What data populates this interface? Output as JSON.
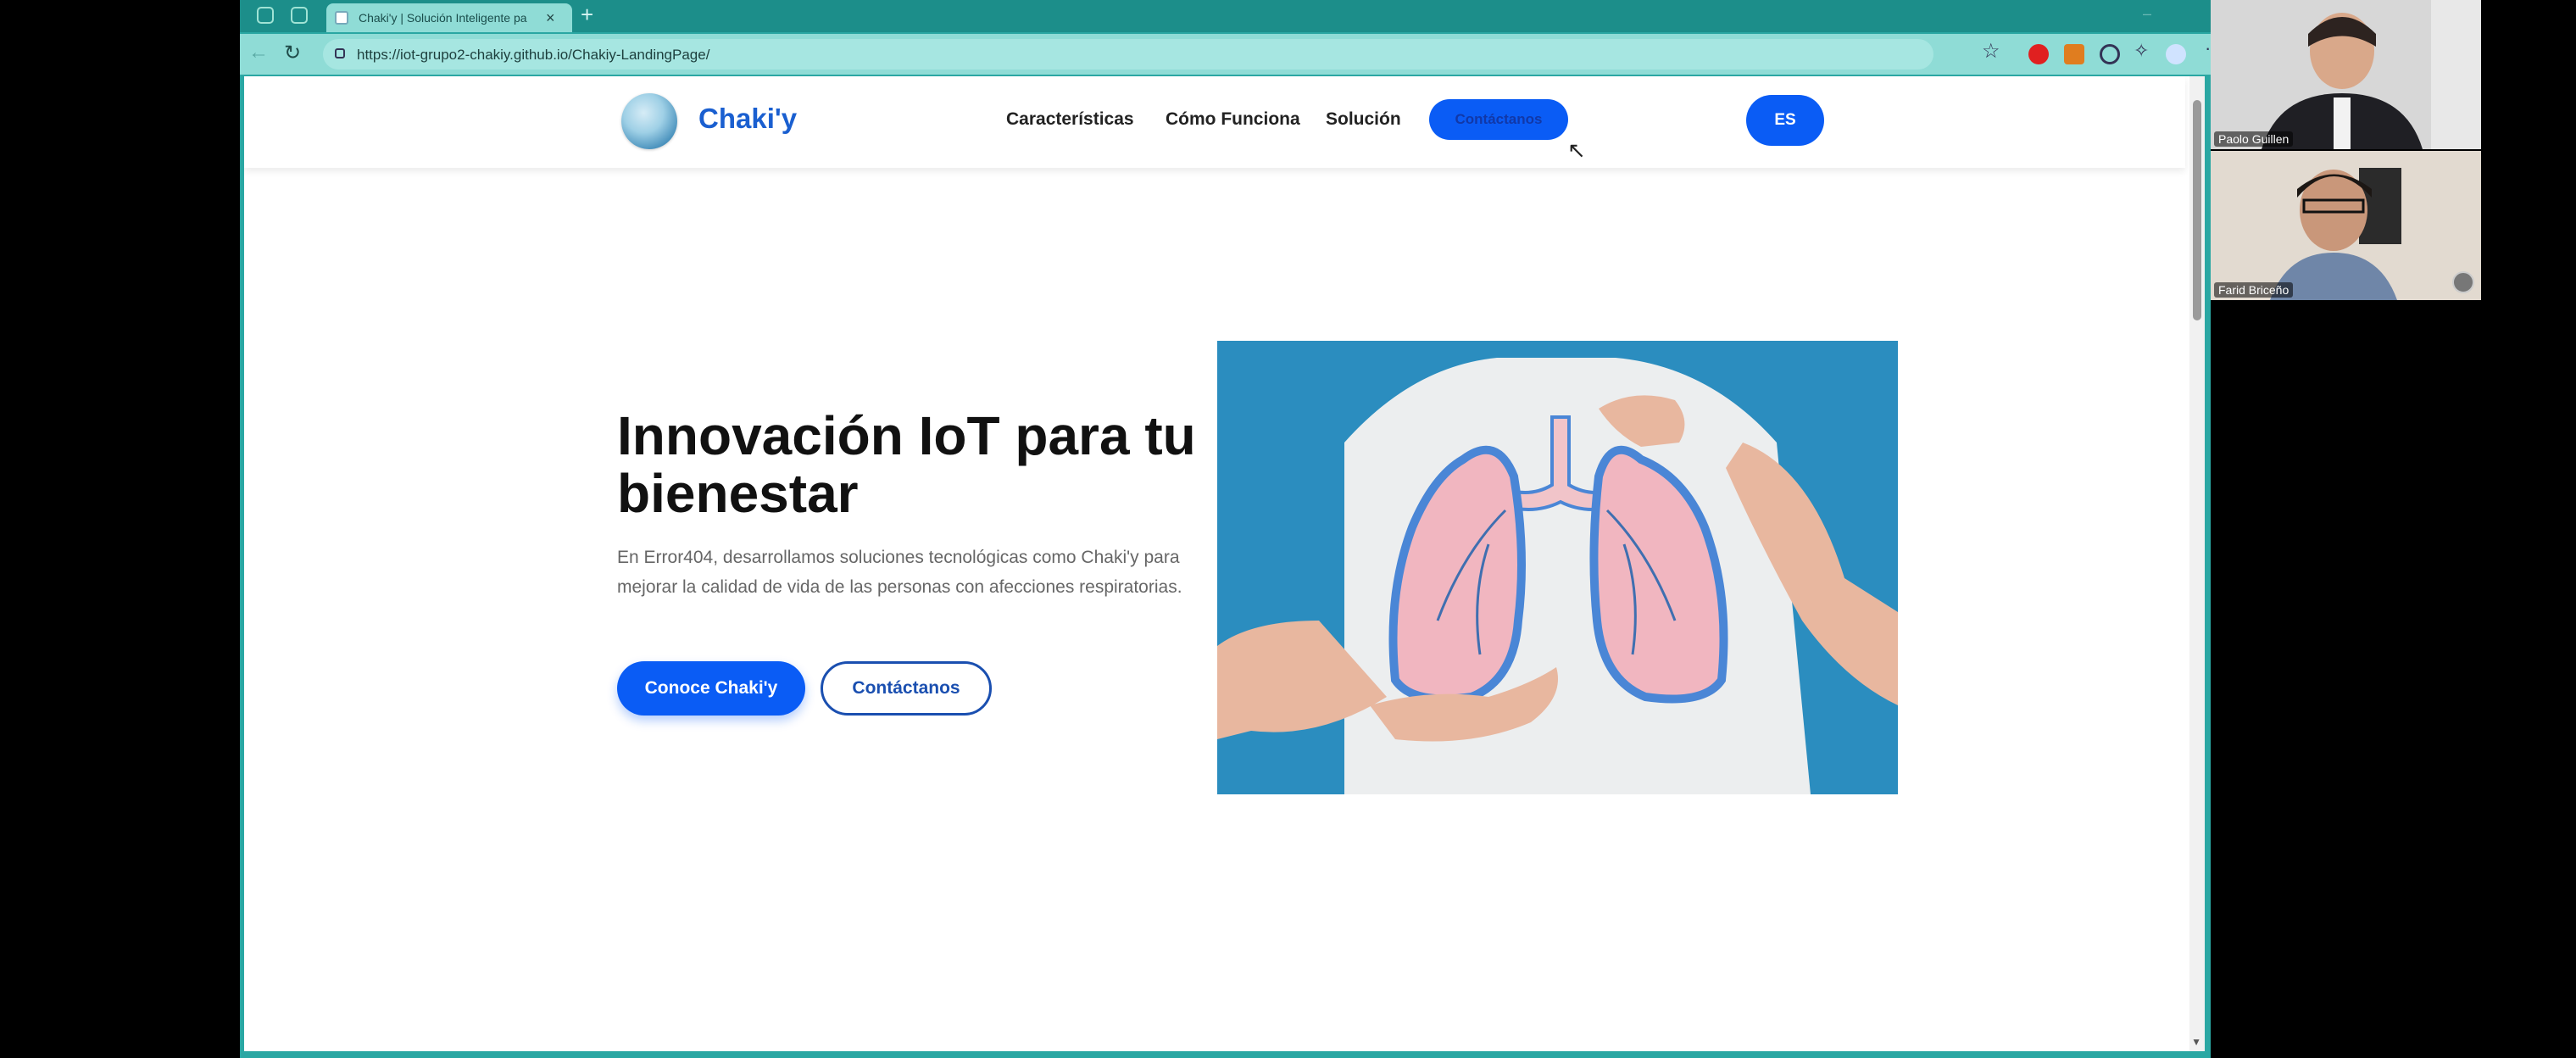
{
  "browser": {
    "tab_title": "Chaki'y | Solución Inteligente pa",
    "tab_close": "×",
    "new_tab": "+",
    "url": "https://iot-grupo2-chakiy.github.io/Chakiy-LandingPage/"
  },
  "icons": {
    "back": "←",
    "reload": "↻",
    "star": "☆",
    "more": "···",
    "cursor": "↖",
    "scroll_down": "▼",
    "extension_puzzle": "✧"
  },
  "site": {
    "logo_text": "Chaki'y",
    "nav": {
      "caracteristicas": "Características",
      "como_funciona": "Cómo Funciona",
      "solucion": "Solución",
      "contact_button": "Contáctanos"
    },
    "lang_button": "ES"
  },
  "hero": {
    "title": "Innovación IoT para tu bienestar",
    "description": "En Error404, desarrollamos soluciones tecnológicas como Chaki'y para mejorar la calidad de vida de las personas con afecciones respiratorias.",
    "primary_button": "Conoce Chaki'y",
    "secondary_button": "Contáctanos"
  },
  "call": {
    "participant_1": "Paolo Guillen",
    "participant_2": "Farid Briceño"
  },
  "colors": {
    "accent": "#0a5cf5",
    "browser_frame": "#2aa7a3",
    "hero_image_bg": "#2b8dbf"
  }
}
